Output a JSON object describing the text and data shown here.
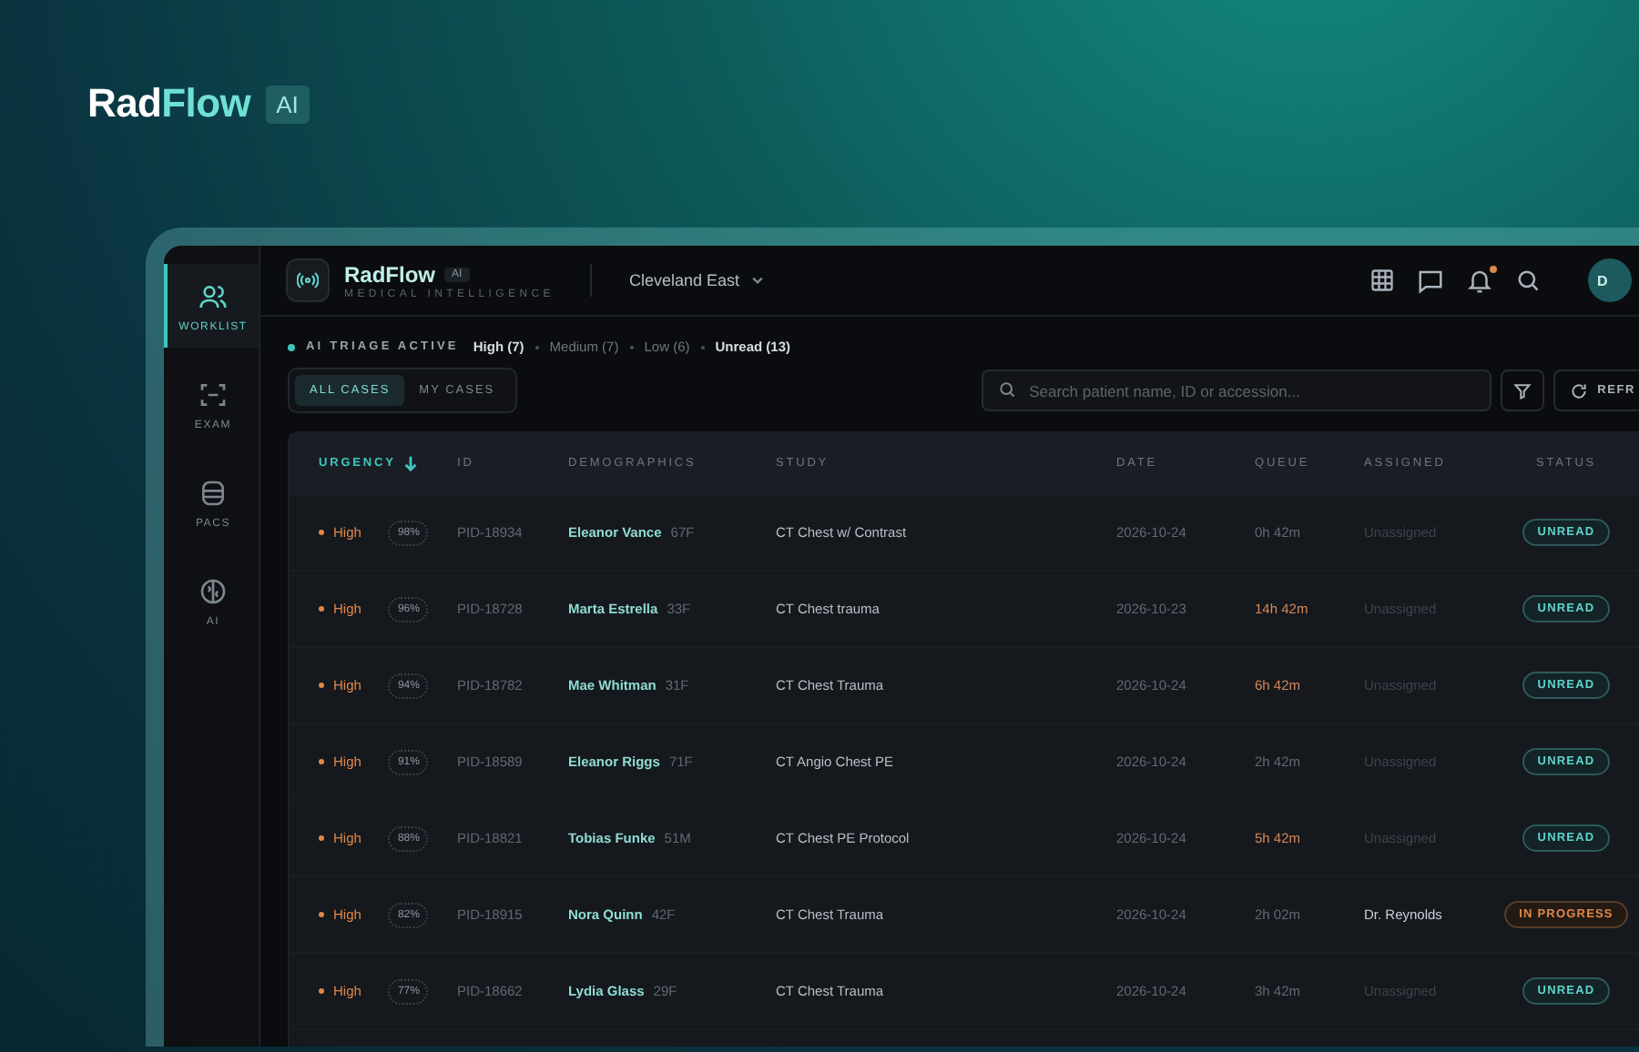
{
  "brand": {
    "name_lead": "Rad",
    "name_accent": "Flow",
    "badge": "AI"
  },
  "sidebar": {
    "items": [
      {
        "label": "WORKLIST",
        "selected": true
      },
      {
        "label": "EXAM",
        "selected": false
      },
      {
        "label": "PACS",
        "selected": false
      },
      {
        "label": "AI",
        "selected": false
      }
    ]
  },
  "header": {
    "app_name": "RadFlow",
    "app_badge": "AI",
    "tagline": "MEDICAL INTELLIGENCE",
    "location": "Cleveland East",
    "notifications_unread": true,
    "avatar": "D"
  },
  "triage": {
    "label": "AI TRIAGE ACTIVE",
    "filters": [
      {
        "label": "High (7)",
        "active": true
      },
      {
        "label": "Medium (7)",
        "active": false
      },
      {
        "label": "Low (6)",
        "active": false
      },
      {
        "label": "Unread (13)",
        "active": true
      }
    ]
  },
  "tabs": [
    {
      "label": "ALL CASES",
      "selected": true
    },
    {
      "label": "MY CASES",
      "selected": false
    }
  ],
  "search": {
    "placeholder": "Search patient name, ID or accession..."
  },
  "refresh_button": "REFR",
  "table": {
    "columns": [
      "URGENCY",
      "ID",
      "DEMOGRAPHICS",
      "STUDY",
      "DATE",
      "QUEUE",
      "ASSIGNED",
      "STATUS"
    ],
    "rows": [
      {
        "urgency": "High",
        "confidence": "98%",
        "id": "PID-18934",
        "name": "Eleanor Vance",
        "demo": "67F",
        "study": "CT Chest w/ Contrast",
        "date": "2026-10-24",
        "queue": "0h 42m",
        "overdue": false,
        "assigned": "Unassigned",
        "unassigned": true,
        "status": {
          "label": "UNREAD",
          "kind": "unread"
        }
      },
      {
        "urgency": "High",
        "confidence": "96%",
        "id": "PID-18728",
        "name": "Marta Estrella",
        "demo": "33F",
        "study": "CT Chest trauma",
        "date": "2026-10-23",
        "queue": "14h 42m",
        "overdue": true,
        "assigned": "Unassigned",
        "unassigned": true,
        "status": {
          "label": "UNREAD",
          "kind": "unread"
        }
      },
      {
        "urgency": "High",
        "confidence": "94%",
        "id": "PID-18782",
        "name": "Mae Whitman",
        "demo": "31F",
        "study": "CT Chest Trauma",
        "date": "2026-10-24",
        "queue": "6h 42m",
        "overdue": true,
        "assigned": "Unassigned",
        "unassigned": true,
        "status": {
          "label": "UNREAD",
          "kind": "unread"
        }
      },
      {
        "urgency": "High",
        "confidence": "91%",
        "id": "PID-18589",
        "name": "Eleanor Riggs",
        "demo": "71F",
        "study": "CT Angio Chest PE",
        "date": "2026-10-24",
        "queue": "2h 42m",
        "overdue": false,
        "assigned": "Unassigned",
        "unassigned": true,
        "status": {
          "label": "UNREAD",
          "kind": "unread"
        }
      },
      {
        "urgency": "High",
        "confidence": "88%",
        "id": "PID-18821",
        "name": "Tobias Funke",
        "demo": "51M",
        "study": "CT Chest PE Protocol",
        "date": "2026-10-24",
        "queue": "5h 42m",
        "overdue": true,
        "assigned": "Unassigned",
        "unassigned": true,
        "status": {
          "label": "UNREAD",
          "kind": "unread"
        }
      },
      {
        "urgency": "High",
        "confidence": "82%",
        "id": "PID-18915",
        "name": "Nora Quinn",
        "demo": "42F",
        "study": "CT Chest Trauma",
        "date": "2026-10-24",
        "queue": "2h 02m",
        "overdue": false,
        "assigned": "Dr. Reynolds",
        "unassigned": false,
        "status": {
          "label": "IN PROGRESS",
          "kind": "in_progress"
        }
      },
      {
        "urgency": "High",
        "confidence": "77%",
        "id": "PID-18662",
        "name": "Lydia Glass",
        "demo": "29F",
        "study": "CT Chest Trauma",
        "date": "2026-10-24",
        "queue": "3h 42m",
        "overdue": false,
        "assigned": "Unassigned",
        "unassigned": true,
        "status": {
          "label": "UNREAD",
          "kind": "unread"
        }
      }
    ]
  }
}
